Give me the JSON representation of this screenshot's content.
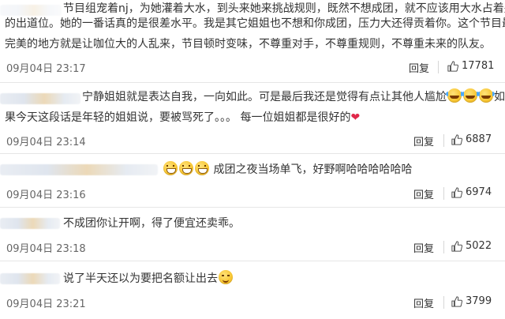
{
  "comments": [
    {
      "text_lines": [
        "节目组宠着nj，为她灌着大水，到头来她来挑战规则，既然不想成团，就不应该用大水占着别人",
        "的出道位。她的一番话真的是很差水平。我是其它姐姐也不想和你成团，压力大还得贡着你。这个节目最不",
        "完美的地方就是让咖位大的人乱来，节目顿时变味，不尊重对手，不尊重规则，不尊重未来的队友。"
      ],
      "date": "09月04日 23:17",
      "reply_label": "回复",
      "likes": "17781"
    },
    {
      "line1": "宁静姐姐就是表达自我，一向如此。可是最后我还是觉得有点让其他人尴尬",
      "line1_tail": "如",
      "line2": "果今天这段话是年轻的姐姐说，要被骂死了。。。 每一位姐姐都是很好的",
      "date": "09月04日 23:14",
      "reply_label": "回复",
      "likes": "6887"
    },
    {
      "text": "成团之夜当场单飞，好野啊哈哈哈哈哈哈",
      "date": "09月04日 23:16",
      "reply_label": "回复",
      "likes": "6974"
    },
    {
      "text": "不成团你让开啊，得了便宜还卖乖。",
      "date": "09月04日 23:18",
      "reply_label": "回复",
      "likes": "5022"
    },
    {
      "text": "说了半天还以为要把名额让出去",
      "date": "09月04日 23:21",
      "reply_label": "回复",
      "likes": "3799"
    }
  ],
  "icons": {
    "like": "thumbs-up-icon",
    "emoji_grin": "grin-emoji-icon",
    "emoji_tears": "tears-of-joy-emoji-icon",
    "emoji_smirk": "smirk-emoji-icon",
    "heart": "red-heart-icon"
  },
  "colors": {
    "text": "#333333",
    "meta": "#666666",
    "heart": "#e0294a"
  }
}
